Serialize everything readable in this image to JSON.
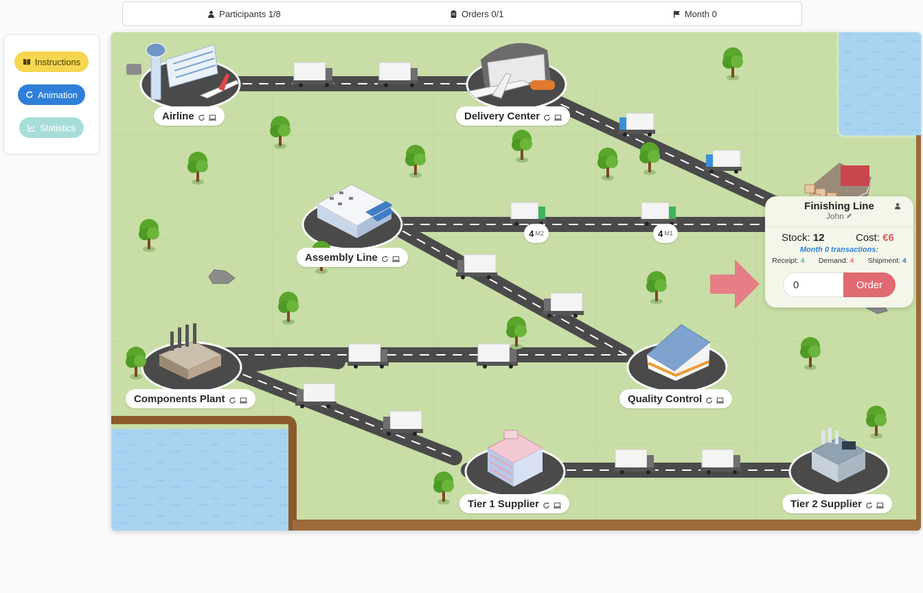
{
  "topbar": {
    "participants": "Participants 1/8",
    "orders": "Orders 0/1",
    "month": "Month 0"
  },
  "controls": {
    "instructions": "Instructions",
    "animation": "Animation",
    "statistics": "Statistics"
  },
  "stations": {
    "airline": "Airline",
    "delivery_center": "Delivery Center",
    "assembly_line": "Assembly Line",
    "components_plant": "Components Plant",
    "quality_control": "Quality Control",
    "tier1_supplier": "Tier 1 Supplier",
    "tier2_supplier": "Tier 2 Supplier"
  },
  "shipments": [
    {
      "count": "4",
      "tag": "M2"
    },
    {
      "count": "4",
      "tag": "M1"
    }
  ],
  "finishing": {
    "title": "Finishing Line",
    "player": "John",
    "stock_label": "Stock:",
    "stock_value": "12",
    "cost_label": "Cost:",
    "cost_value": "€6",
    "transactions": "Month 0 transactions:",
    "receipt_label": "Receipt:",
    "receipt_value": "4",
    "demand_label": "Demand:",
    "demand_value": "4",
    "shipment_label": "Shipment:",
    "shipment_value": "4",
    "order_input_value": "0",
    "order_button": "Order"
  },
  "colors": {
    "grass": "#c8dea6",
    "water": "#a8d4f2",
    "road": "#4a4a4a",
    "accent_order": "#e06a72",
    "accent_instructions": "#f6d651",
    "accent_animation": "#2f7fd9",
    "accent_statistics": "#a7ddd8"
  },
  "icons": {
    "participants": "person-icon",
    "orders": "clipboard-icon",
    "month": "flag-icon",
    "instructions": "book-icon",
    "animation": "refresh-icon",
    "statistics": "chart-icon",
    "station_status": [
      "refresh-icon",
      "computer-icon"
    ]
  }
}
